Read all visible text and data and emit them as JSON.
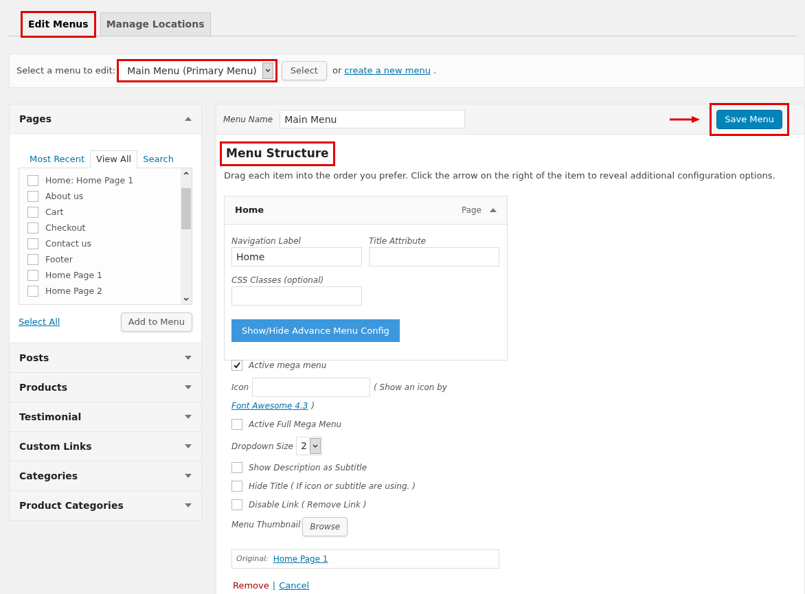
{
  "tabs": [
    {
      "label": "Edit Menus",
      "selected": true,
      "highlighted": true
    },
    {
      "label": "Manage Locations",
      "selected": false,
      "highlighted": false
    }
  ],
  "select_bar": {
    "label": "Select a menu to edit:",
    "value": "Main Menu (Primary Menu)",
    "highlighted": true,
    "button": "Select",
    "or_text": "or",
    "link": "create a new menu",
    "end": "."
  },
  "sidebar": {
    "pages": {
      "title": "Pages",
      "expanded": true,
      "tabs": [
        {
          "label": "Most Recent",
          "selected": false
        },
        {
          "label": "View All",
          "selected": true
        },
        {
          "label": "Search",
          "selected": false
        }
      ],
      "items": [
        {
          "label": "Home: Home Page 1",
          "checked": false
        },
        {
          "label": "About us",
          "checked": false
        },
        {
          "label": "Cart",
          "checked": false
        },
        {
          "label": "Checkout",
          "checked": false
        },
        {
          "label": "Contact us",
          "checked": false
        },
        {
          "label": "Footer",
          "checked": false
        },
        {
          "label": "Home Page 1",
          "checked": false
        },
        {
          "label": "Home Page 2",
          "checked": false
        }
      ],
      "select_all": "Select All",
      "add_button": "Add to Menu"
    },
    "sections": [
      {
        "title": "Posts",
        "expanded": false
      },
      {
        "title": "Products",
        "expanded": false
      },
      {
        "title": "Testimonial",
        "expanded": false
      },
      {
        "title": "Custom Links",
        "expanded": false
      },
      {
        "title": "Categories",
        "expanded": false
      },
      {
        "title": "Product Categories",
        "expanded": false
      }
    ]
  },
  "editor": {
    "menu_name_label": "Menu Name",
    "menu_name": "Main Menu",
    "save_button": "Save Menu",
    "save_highlighted": true,
    "heading": "Menu Structure",
    "heading_highlighted": true,
    "instructions": "Drag each item into the order you prefer. Click the arrow on the right of the item to reveal additional configuration options.",
    "item": {
      "title": "Home",
      "type": "Page",
      "expanded": true,
      "nav_label": "Navigation Label",
      "nav_value": "Home",
      "title_attr_label": "Title Attribute",
      "css_label": "CSS Classes (optional)",
      "config_button": "Show/Hide Advance Menu Config"
    },
    "options": [
      {
        "kind": "checkbox",
        "label": "Active mega menu",
        "checked": true
      },
      {
        "kind": "icon",
        "label": "Icon",
        "hint": "( Show an icon by",
        "link": "Font Awesome 4.3",
        "hint_end": ")"
      },
      {
        "kind": "checkbox",
        "label": "Active Full Mega Menu",
        "checked": false
      },
      {
        "kind": "select",
        "label": "Dropdown Size",
        "value": "2"
      },
      {
        "kind": "checkbox",
        "label": "Show Description as Subtitle",
        "checked": false
      },
      {
        "kind": "checkbox",
        "label": "Hide Title ( If icon or subtitle are using. )",
        "checked": false
      },
      {
        "kind": "checkbox",
        "label": "Disable Link ( Remove Link )",
        "checked": false
      },
      {
        "kind": "thumbnail",
        "label": "Menu Thumbnail",
        "button": "Browse"
      }
    ],
    "original_label": "Original:",
    "original_link": "Home Page 1",
    "remove": "Remove",
    "separator": "|",
    "cancel": "Cancel"
  }
}
